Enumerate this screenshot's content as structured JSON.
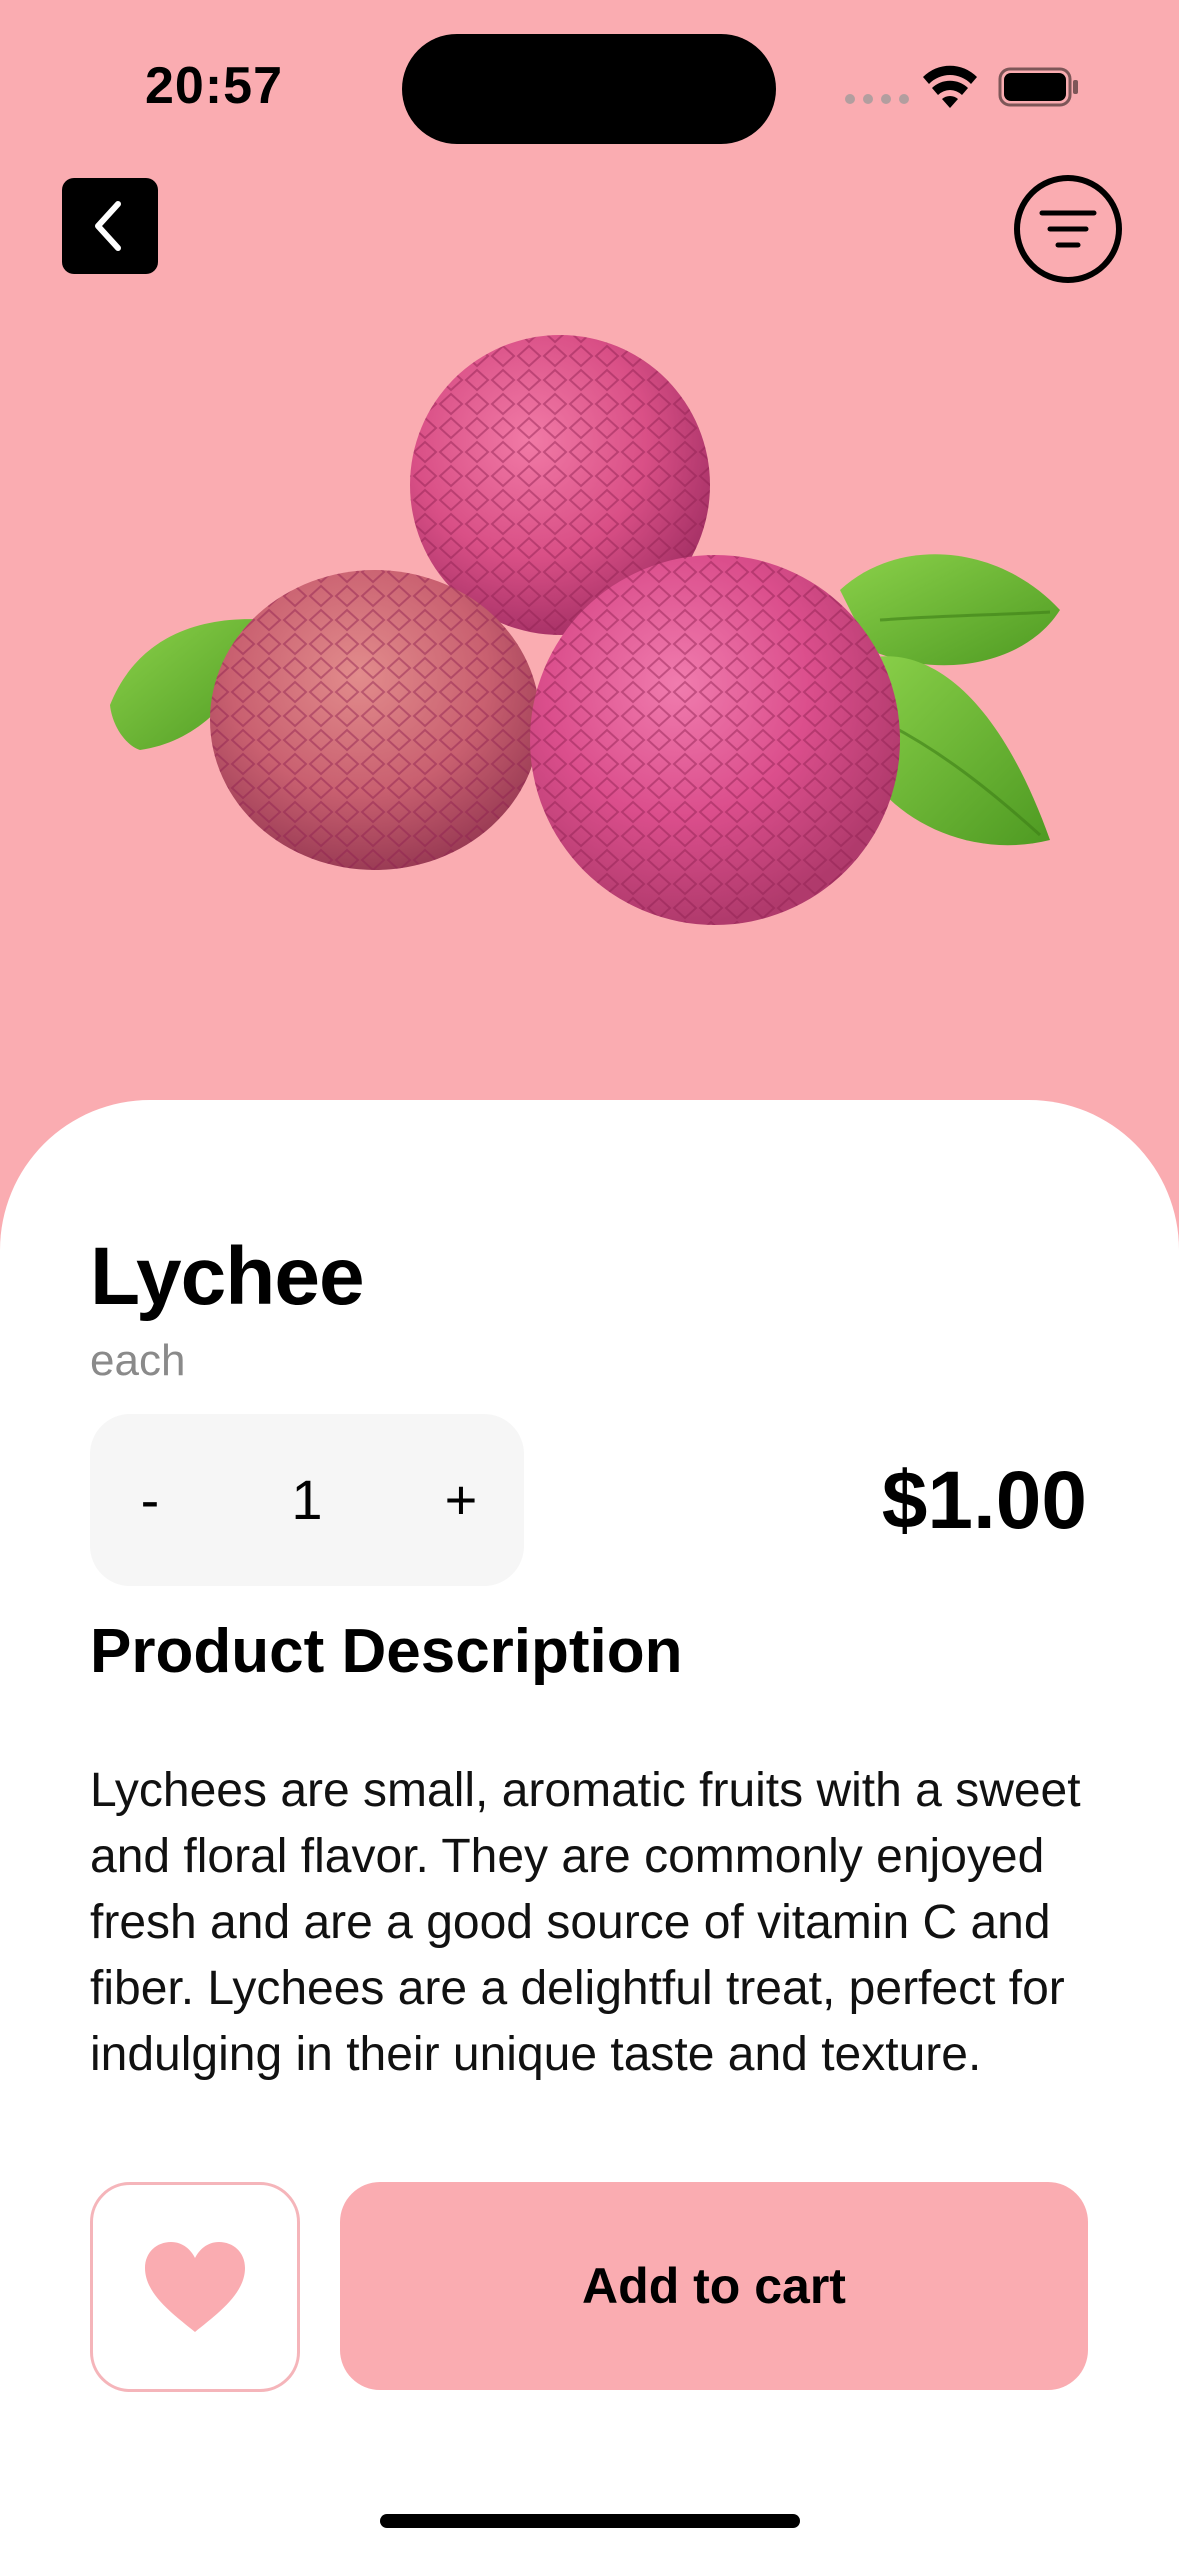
{
  "status_bar": {
    "time": "20:57",
    "icons": [
      "signal-icon",
      "wifi-icon",
      "battery-icon"
    ]
  },
  "header": {
    "back_icon": "chevron-left-icon",
    "filter_icon": "filter-icon"
  },
  "product": {
    "name": "Lychee",
    "unit": "each",
    "quantity": {
      "minus_label": "-",
      "value": "1",
      "plus_label": "+"
    },
    "price": "$1.00",
    "image": "lychee-fruit-image"
  },
  "description": {
    "heading": "Product Description",
    "text": "Lychees are small, aromatic fruits with a sweet and floral flavor. They are commonly enjoyed fresh and are a good source of vitamin C and fiber. Lychees are a delightful treat, perfect for indulging in their unique taste and texture."
  },
  "actions": {
    "favorite_icon": "heart-icon",
    "add_to_cart_label": "Add to cart"
  },
  "colors": {
    "accent": "#FAACB1",
    "background": "#FFFFFF",
    "text": "#000000",
    "muted": "#8A8A8A",
    "stepper_bg": "#F6F6F6"
  }
}
